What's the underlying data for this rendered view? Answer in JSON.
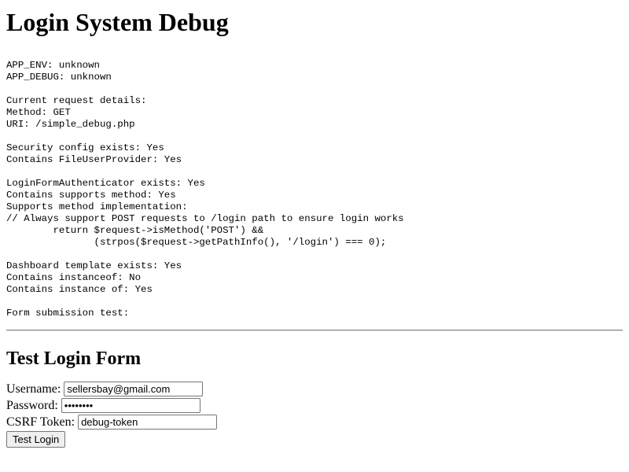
{
  "page": {
    "title": "Login System Debug"
  },
  "debug": {
    "output": "APP_ENV: unknown\nAPP_DEBUG: unknown\n\nCurrent request details:\nMethod: GET\nURI: /simple_debug.php\n\nSecurity config exists: Yes\nContains FileUserProvider: Yes\n\nLoginFormAuthenticator exists: Yes\nContains supports method: Yes\nSupports method implementation:\n// Always support POST requests to /login path to ensure login works\n        return $request->isMethod('POST') &&\n               (strpos($request->getPathInfo(), '/login') === 0);\n\nDashboard template exists: Yes\nContains instanceof: No\nContains instance of: Yes\n\nForm submission test:"
  },
  "form": {
    "title": "Test Login Form",
    "username_label": "Username:",
    "username_value": "sellersbay@gmail.com",
    "password_label": "Password:",
    "password_value": "password",
    "csrf_label": "CSRF Token:",
    "csrf_value": "debug-token",
    "submit_label": "Test Login"
  }
}
